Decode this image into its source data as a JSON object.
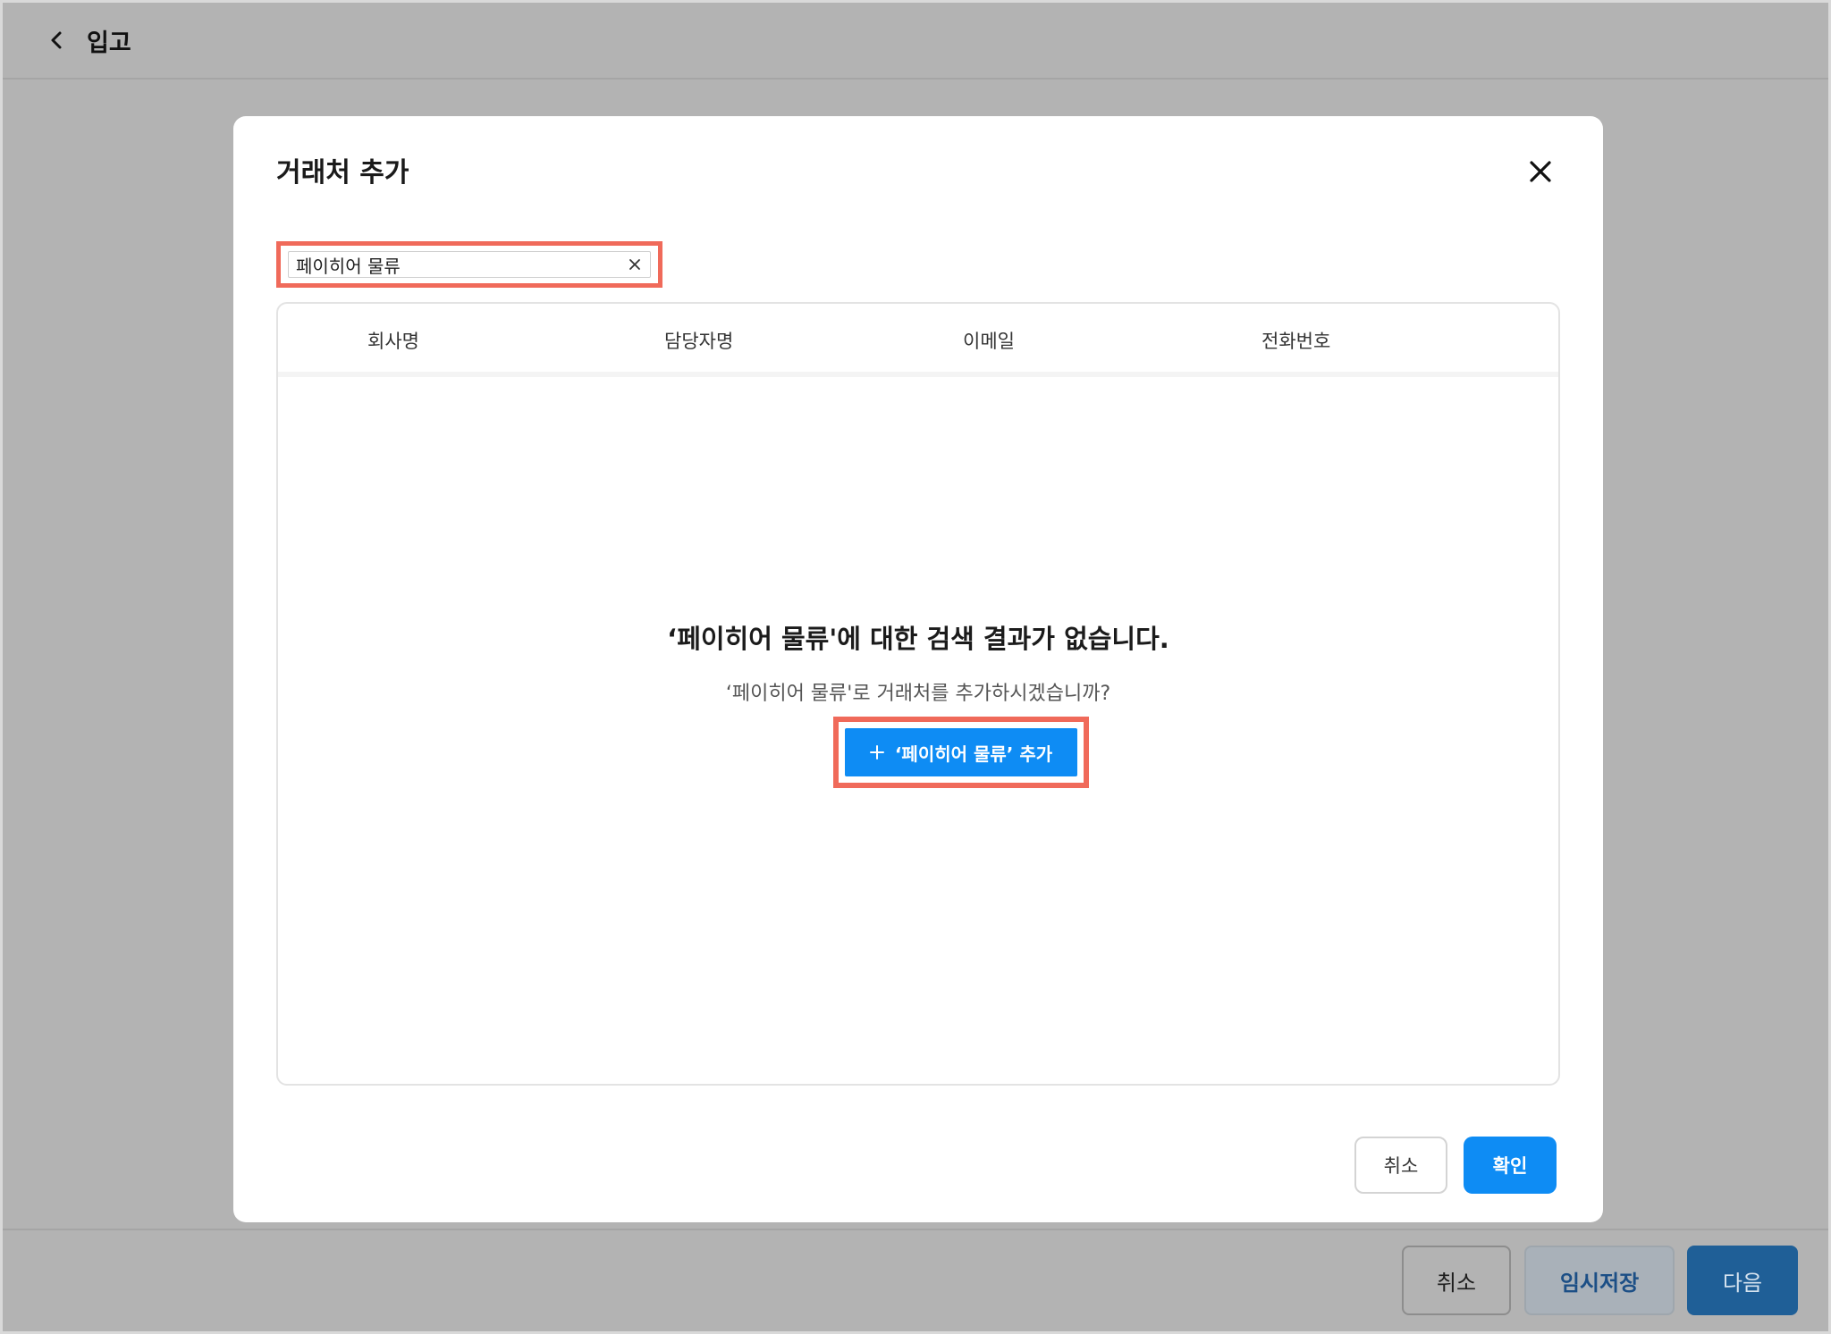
{
  "page": {
    "title": "입고",
    "footer": {
      "cancel_label": "취소",
      "draft_label": "임시저장",
      "next_label": "다음"
    }
  },
  "modal": {
    "title": "거래처 추가",
    "search": {
      "value": "페이히어 물류",
      "placeholder": ""
    },
    "table": {
      "columns": [
        "회사명",
        "담당자명",
        "이메일",
        "전화번호"
      ]
    },
    "empty_state": {
      "title": "‘페이히어 물류'에 대한 검색 결과가 없습니다.",
      "subtitle": "‘페이히어 물류'로 거래처를 추가하시겠습니까?",
      "add_button_label": "‘페이히어 물류’ 추가"
    },
    "buttons": {
      "cancel_label": "취소",
      "confirm_label": "확인"
    }
  },
  "colors": {
    "primary": "#0e8cf4",
    "highlight": "#f06a5a",
    "overlay": "#b3b3b3"
  },
  "icons": {
    "back": "chevron-left-icon",
    "close": "close-icon",
    "clear": "clear-icon",
    "add": "plus-icon"
  }
}
